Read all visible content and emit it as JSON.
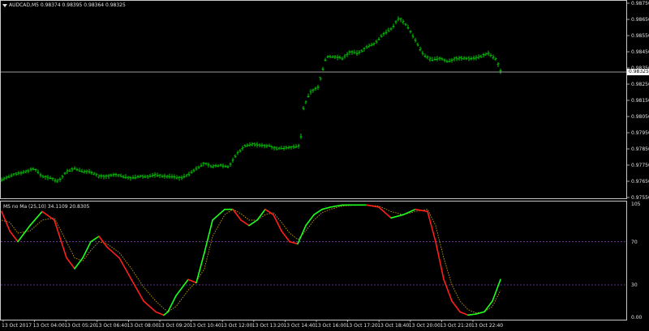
{
  "symbol_header": {
    "text": "AUDCAD,M5  0.98374 0.98395 0.98364 0.98325"
  },
  "indicator_header": {
    "text": "MS no Ma (25,10) 34.1109 20.8305"
  },
  "current_price": "0.98325",
  "colors": {
    "background": "#000000",
    "bars": "#00c800",
    "signal_up": "#1eff1e",
    "signal_down": "#ff1e1e",
    "dotted": "#c8a000",
    "level": "#8040c0"
  },
  "price_axis": {
    "labels": [
      "0.98750",
      "0.98650",
      "0.98550",
      "0.98450",
      "0.98350",
      "0.98250",
      "0.98150",
      "0.98050",
      "0.97950",
      "0.97850",
      "0.97750",
      "0.97650",
      "0.97550"
    ]
  },
  "indicator_axis": {
    "labels": [
      "105",
      "70",
      "30",
      "0.00"
    ]
  },
  "time_axis": {
    "labels": [
      "13 Oct 2017",
      "13 Oct 04:00",
      "13 Oct 05:20",
      "13 Oct 06:40",
      "13 Oct 08:00",
      "13 Oct 09:20",
      "13 Oct 10:40",
      "13 Oct 12:00",
      "13 Oct 13:20",
      "13 Oct 14:40",
      "13 Oct 16:00",
      "13 Oct 17:20",
      "13 Oct 18:40",
      "13 Oct 20:00",
      "13 Oct 21:20",
      "13 Oct 22:40"
    ]
  },
  "chart_data": [
    {
      "type": "line",
      "title": "AUDCAD,M5",
      "ylim": [
        0.9755,
        0.9876
      ],
      "x": [
        0,
        10,
        20,
        30,
        40,
        50,
        60,
        70,
        80,
        90,
        100,
        110,
        120,
        130,
        140,
        150,
        160,
        170,
        180,
        190,
        200,
        210,
        220,
        230,
        240,
        250,
        260,
        270,
        280,
        290,
        300,
        310,
        320,
        330,
        340,
        350,
        360,
        368,
        372,
        380,
        390,
        400,
        410,
        420,
        430,
        440,
        450,
        460,
        470,
        480,
        490,
        500,
        510,
        520,
        530,
        540,
        550,
        560,
        570,
        580,
        590,
        600,
        610,
        615
      ],
      "series": [
        {
          "values": [
            0.9766,
            0.9768,
            0.977,
            0.9771,
            0.9773,
            0.9768,
            0.9767,
            0.9765,
            0.9771,
            0.9773,
            0.9771,
            0.9771,
            0.9768,
            0.9768,
            0.9769,
            0.9768,
            0.9767,
            0.9768,
            0.9768,
            0.9769,
            0.9768,
            0.9768,
            0.9767,
            0.9769,
            0.9773,
            0.9776,
            0.9774,
            0.9775,
            0.9774,
            0.9782,
            0.9787,
            0.9788,
            0.9787,
            0.9787,
            0.9785,
            0.9786,
            0.9786,
            0.9787,
            0.981,
            0.982,
            0.9823,
            0.9842,
            0.9842,
            0.9841,
            0.9845,
            0.9844,
            0.9848,
            0.985,
            0.9856,
            0.9859,
            0.9866,
            0.9861,
            0.9852,
            0.9843,
            0.984,
            0.9841,
            0.9839,
            0.9841,
            0.9841,
            0.9841,
            0.9842,
            0.9844,
            0.984,
            0.9833
          ]
        }
      ]
    },
    {
      "type": "line",
      "title": "MS no Ma (25,10)",
      "ylim": [
        0,
        105
      ],
      "x": [
        0,
        10,
        20,
        35,
        50,
        65,
        80,
        90,
        100,
        110,
        120,
        130,
        145,
        160,
        175,
        190,
        200,
        205,
        215,
        230,
        240,
        250,
        260,
        275,
        285,
        295,
        305,
        315,
        325,
        335,
        345,
        355,
        365,
        375,
        385,
        395,
        405,
        420,
        435,
        450,
        465,
        480,
        495,
        510,
        525,
        535,
        545,
        555,
        565,
        575,
        585,
        595,
        605,
        615
      ],
      "series": [
        {
          "name": "signal",
          "values": [
            98,
            80,
            70,
            85,
            98,
            90,
            55,
            45,
            55,
            70,
            75,
            65,
            55,
            35,
            15,
            5,
            2,
            5,
            20,
            35,
            32,
            60,
            90,
            100,
            100,
            90,
            85,
            90,
            100,
            95,
            80,
            70,
            68,
            85,
            95,
            100,
            102,
            104,
            104,
            104,
            102,
            92,
            95,
            100,
            98,
            70,
            35,
            15,
            5,
            2,
            3,
            5,
            15,
            35
          ]
        },
        {
          "name": "signal dotted",
          "values": [
            90,
            88,
            78,
            80,
            90,
            92,
            70,
            55,
            52,
            62,
            70,
            68,
            60,
            45,
            28,
            15,
            8,
            5,
            10,
            25,
            33,
            45,
            75,
            95,
            100,
            96,
            90,
            90,
            95,
            97,
            88,
            78,
            72,
            80,
            90,
            97,
            100,
            103,
            104,
            104,
            103,
            98,
            95,
            98,
            100,
            85,
            55,
            30,
            15,
            7,
            4,
            5,
            10,
            25
          ]
        }
      ]
    }
  ]
}
